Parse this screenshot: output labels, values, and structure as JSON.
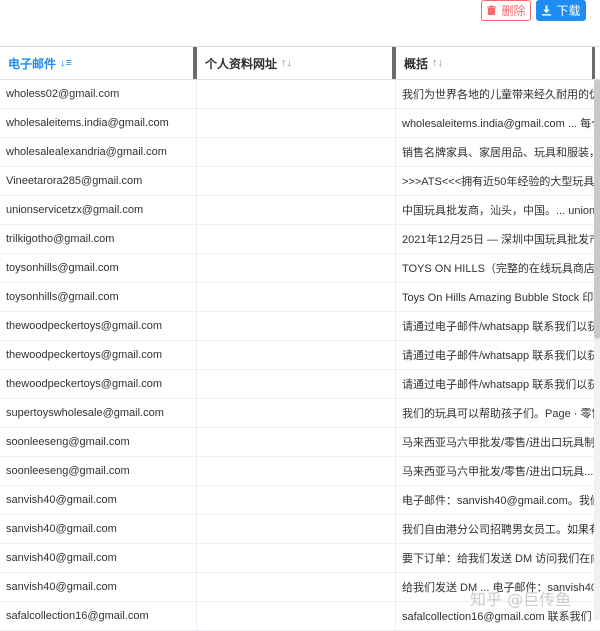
{
  "toolbar": {
    "delete_label": "删除",
    "download_label": "下载"
  },
  "columns": [
    {
      "label": "电子邮件",
      "sort_icon": "↓≡"
    },
    {
      "label": "个人资料网址",
      "sort_icon": "↑↓"
    },
    {
      "label": "概括",
      "sort_icon": "↑↓"
    }
  ],
  "rows": [
    {
      "email": "wholess02@gmail.com",
      "profile": "",
      "summary": "我们为世界各地的儿童带来经久耐用的优"
    },
    {
      "email": "wholesaleitems.india@gmail.com",
      "profile": "",
      "summary": "wholesaleitems.india@gmail.com ... 每个"
    },
    {
      "email": "wholesalealexandria@gmail.com",
      "profile": "",
      "summary": "销售名牌家具、家居用品、玩具和服装，"
    },
    {
      "email": "Vineetarora285@gmail.com",
      "profile": "",
      "summary": ">>>ATS<<<拥有近50年经验的大型玩具"
    },
    {
      "email": "unionservicetzx@gmail.com",
      "profile": "",
      "summary": "中国玩具批发商，汕头，中国。... unions"
    },
    {
      "email": "trilkigotho@gmail.com",
      "profile": "",
      "summary": "2021年12月25日 — 深圳中国玩具批发市"
    },
    {
      "email": "toysonhills@gmail.com",
      "profile": "",
      "summary": "TOYS ON HILLS（完整的在线玩具商店）"
    },
    {
      "email": "toysonhills@gmail.com",
      "profile": "",
      "summary": "Toys On Hills Amazing Bubble Stock 印度"
    },
    {
      "email": "thewoodpeckertoys@gmail.com",
      "profile": "",
      "summary": "请通过电子邮件/whatsapp 联系我们以获"
    },
    {
      "email": "thewoodpeckertoys@gmail.com",
      "profile": "",
      "summary": "请通过电子邮件/whatsapp 联系我们以获"
    },
    {
      "email": "thewoodpeckertoys@gmail.com",
      "profile": "",
      "summary": "请通过电子邮件/whatsapp 联系我们以获"
    },
    {
      "email": "supertoyswholesale@gmail.com",
      "profile": "",
      "summary": "我们的玩具可以帮助孩子们。Page · 零售"
    },
    {
      "email": "soonleeseng@gmail.com",
      "profile": "",
      "summary": "马来西亚马六甲批发/零售/进出口玩具制"
    },
    {
      "email": "soonleeseng@gmail.com",
      "profile": "",
      "summary": "马来西亚马六甲批发/零售/进出口玩具..."
    },
    {
      "email": "sanvish40@gmail.com",
      "profile": "",
      "summary": "电子邮件：sanvish40@gmail.com。我们"
    },
    {
      "email": "sanvish40@gmail.com",
      "profile": "",
      "summary": "我们自由港分公司招聘男女员工。如果有"
    },
    {
      "email": "sanvish40@gmail.com",
      "profile": "",
      "summary": "要下订单：给我们发送 DM 访问我们在向"
    },
    {
      "email": "sanvish40@gmail.com",
      "profile": "",
      "summary": "给我们发送 DM ... 电子邮件：sanvish40c"
    },
    {
      "email": "safalcollection16@gmail.com",
      "profile": "",
      "summary": "safalcollection16@gmail.com 联系我们"
    }
  ],
  "watermark": "知乎 @巨传鱼",
  "colors": {
    "accent": "#1f8cef",
    "danger": "#f56c6c"
  },
  "icons": {
    "delete": "trash-icon",
    "download": "download-icon"
  }
}
